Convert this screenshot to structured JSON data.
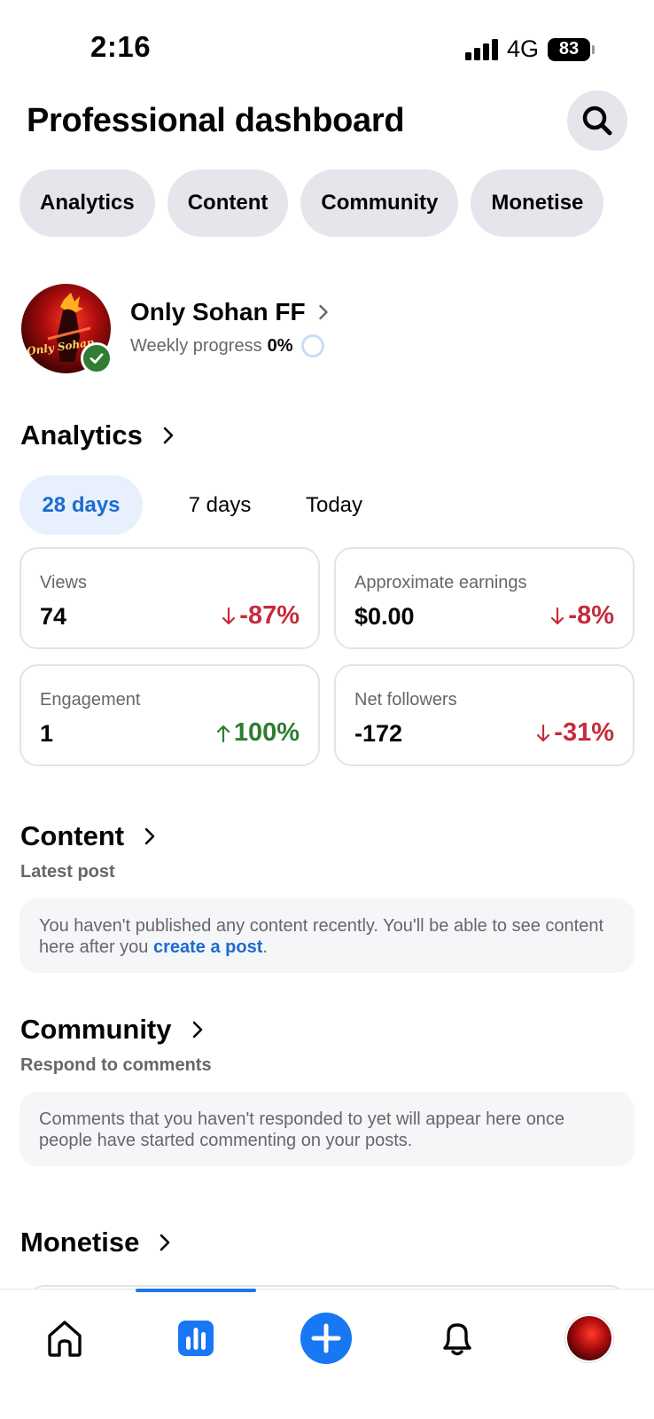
{
  "status_bar": {
    "time": "2:16",
    "network": "4G",
    "battery": "83"
  },
  "header": {
    "title": "Professional dashboard"
  },
  "chips": [
    {
      "label": "Analytics"
    },
    {
      "label": "Content"
    },
    {
      "label": "Community"
    },
    {
      "label": "Monetise"
    }
  ],
  "profile": {
    "name": "Only Sohan FF",
    "avatar_text": "Only Sohan",
    "weekly_label": "Weekly progress",
    "weekly_value": "0%"
  },
  "analytics": {
    "title": "Analytics",
    "date_tabs": [
      {
        "label": "28 days",
        "selected": true
      },
      {
        "label": "7 days",
        "selected": false
      },
      {
        "label": "Today",
        "selected": false
      }
    ],
    "metrics": [
      {
        "label": "Views",
        "value": "74",
        "change": "-87%",
        "direction": "down"
      },
      {
        "label": "Approximate earnings",
        "value": "$0.00",
        "change": "-8%",
        "direction": "down"
      },
      {
        "label": "Engagement",
        "value": "1",
        "change": "100%",
        "direction": "up"
      },
      {
        "label": "Net followers",
        "value": "-172",
        "change": "-31%",
        "direction": "down"
      }
    ]
  },
  "content": {
    "title": "Content",
    "subtitle": "Latest post",
    "message": "You haven't published any content recently. You'll be able to see content here after you ",
    "link": "create a post",
    "message_end": "."
  },
  "community": {
    "title": "Community",
    "subtitle": "Respond to comments",
    "message": "Comments that you haven't responded to yet will appear here once people have started commenting on your posts."
  },
  "monetise": {
    "title": "Monetise"
  },
  "colors": {
    "accent": "#1877f2",
    "negative": "#c62b3c",
    "positive": "#2e7d32",
    "chip_bg": "#e4e6eb"
  },
  "bottom_nav": [
    {
      "icon": "home-icon"
    },
    {
      "icon": "bar-chart-icon",
      "selected": true
    },
    {
      "icon": "plus-icon"
    },
    {
      "icon": "bell-icon"
    },
    {
      "icon": "profile-avatar"
    }
  ]
}
